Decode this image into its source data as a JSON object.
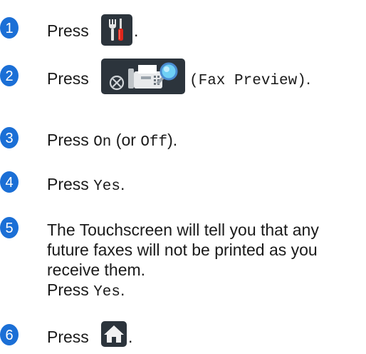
{
  "steps": [
    {
      "number": "1",
      "press": "Press",
      "after": "."
    },
    {
      "number": "2",
      "press": "Press",
      "label": "(Fax Preview)",
      "after": "."
    },
    {
      "number": "3",
      "press": "Press",
      "on": "On",
      "or_open": "(or",
      "off": "Off",
      "close": ")."
    },
    {
      "number": "4",
      "press": "Press",
      "yes": "Yes",
      "dot": "."
    },
    {
      "number": "5",
      "line1": "The Touchscreen will tell you that any",
      "line2": "future faxes will not be printed as you",
      "line3": "receive them.",
      "press": "Press",
      "yes": "Yes",
      "dot": "."
    },
    {
      "number": "6",
      "press": "Press",
      "after": "."
    }
  ],
  "icons": {
    "settings": "settings-tools-icon",
    "fax_preview": "fax-preview-icon",
    "home": "home-icon"
  },
  "colors": {
    "badge": "#1b6fd6",
    "icon_bg": "#2c343c",
    "text": "#1a1a1a"
  }
}
